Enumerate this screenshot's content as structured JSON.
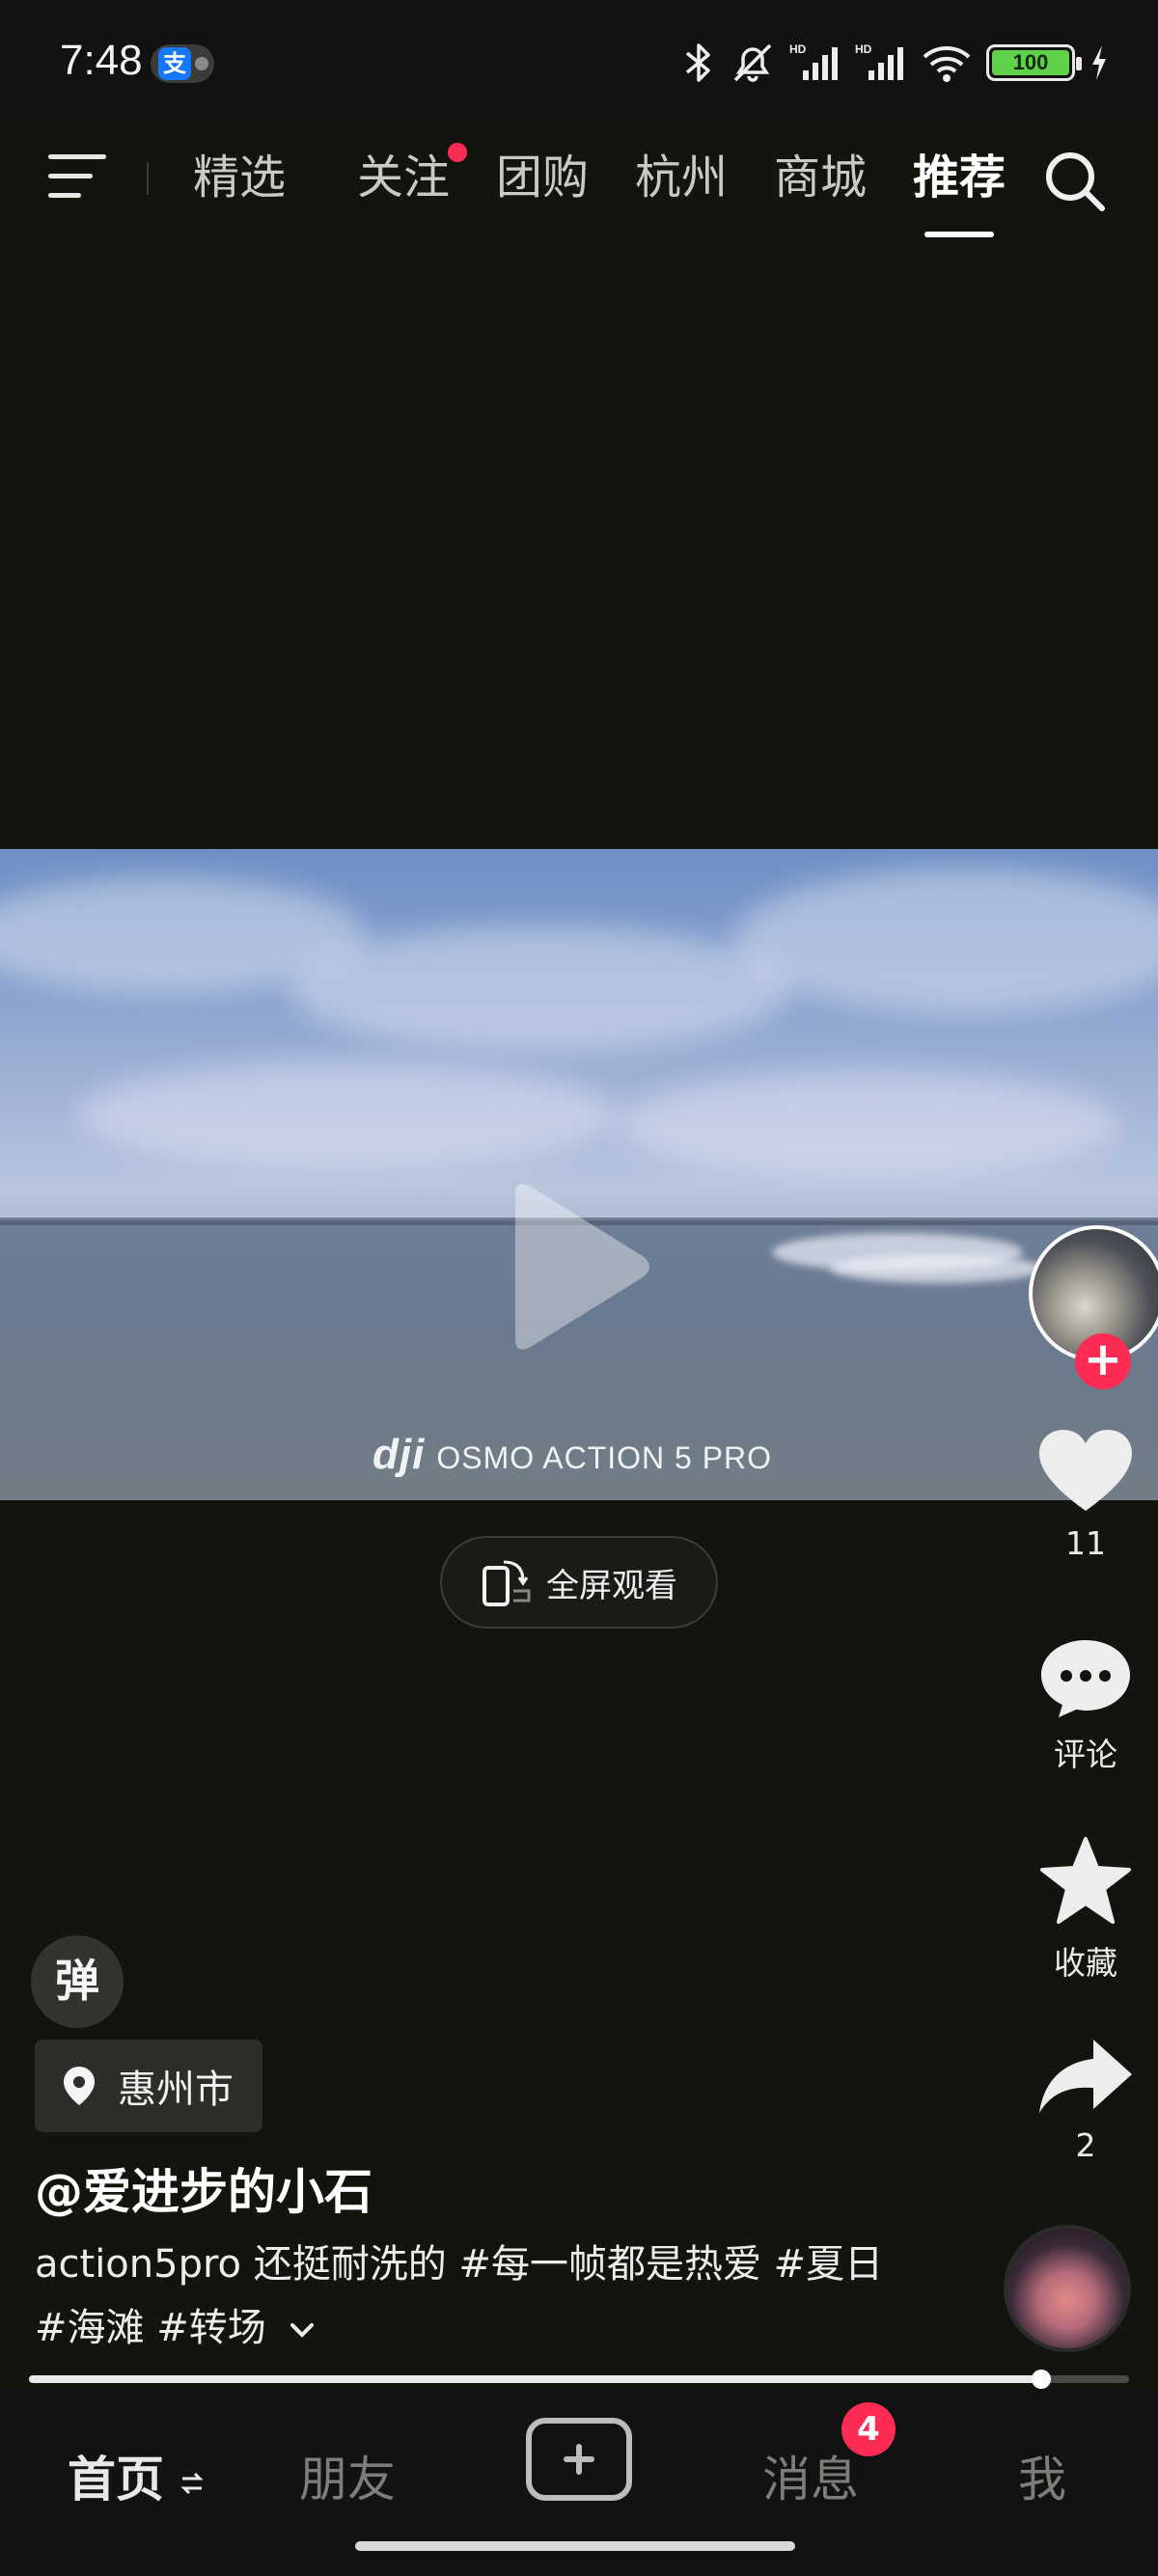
{
  "status_bar": {
    "time": "7:48",
    "alipay_icon": "支",
    "battery": "100",
    "icons": [
      "bluetooth-icon",
      "mute-icon",
      "signal-hd-icon",
      "signal-hd-icon",
      "wifi-icon",
      "battery-icon",
      "charging-icon"
    ]
  },
  "top_nav": {
    "tabs": [
      {
        "label": "精选",
        "active": false
      },
      {
        "label": "关注",
        "active": false,
        "dot": true
      },
      {
        "label": "团购",
        "active": false
      },
      {
        "label": "杭州",
        "active": false
      },
      {
        "label": "商城",
        "active": false
      },
      {
        "label": "推荐",
        "active": true
      }
    ]
  },
  "video": {
    "watermark_brand": "dji",
    "watermark_text": "OSMO ACTION 5 PRO",
    "fullscreen_label": "全屏观看",
    "progress": 0.92
  },
  "rail": {
    "like_count": "11",
    "comment_label": "评论",
    "favorite_label": "收藏",
    "share_count": "2",
    "follow_symbol": "+"
  },
  "info": {
    "danmu_label": "弹",
    "location": "惠州市",
    "author": "@爱进步的小石",
    "description": "action5pro 还挺耐洗的 #每一帧都是热爱 #夏日 #海滩 #转场"
  },
  "bottom_bar": {
    "home": "首页",
    "friends": "朋友",
    "messages": "消息",
    "messages_badge": "4",
    "me": "我"
  },
  "colors": {
    "accent": "#fe2c55",
    "background": "#14140f"
  }
}
